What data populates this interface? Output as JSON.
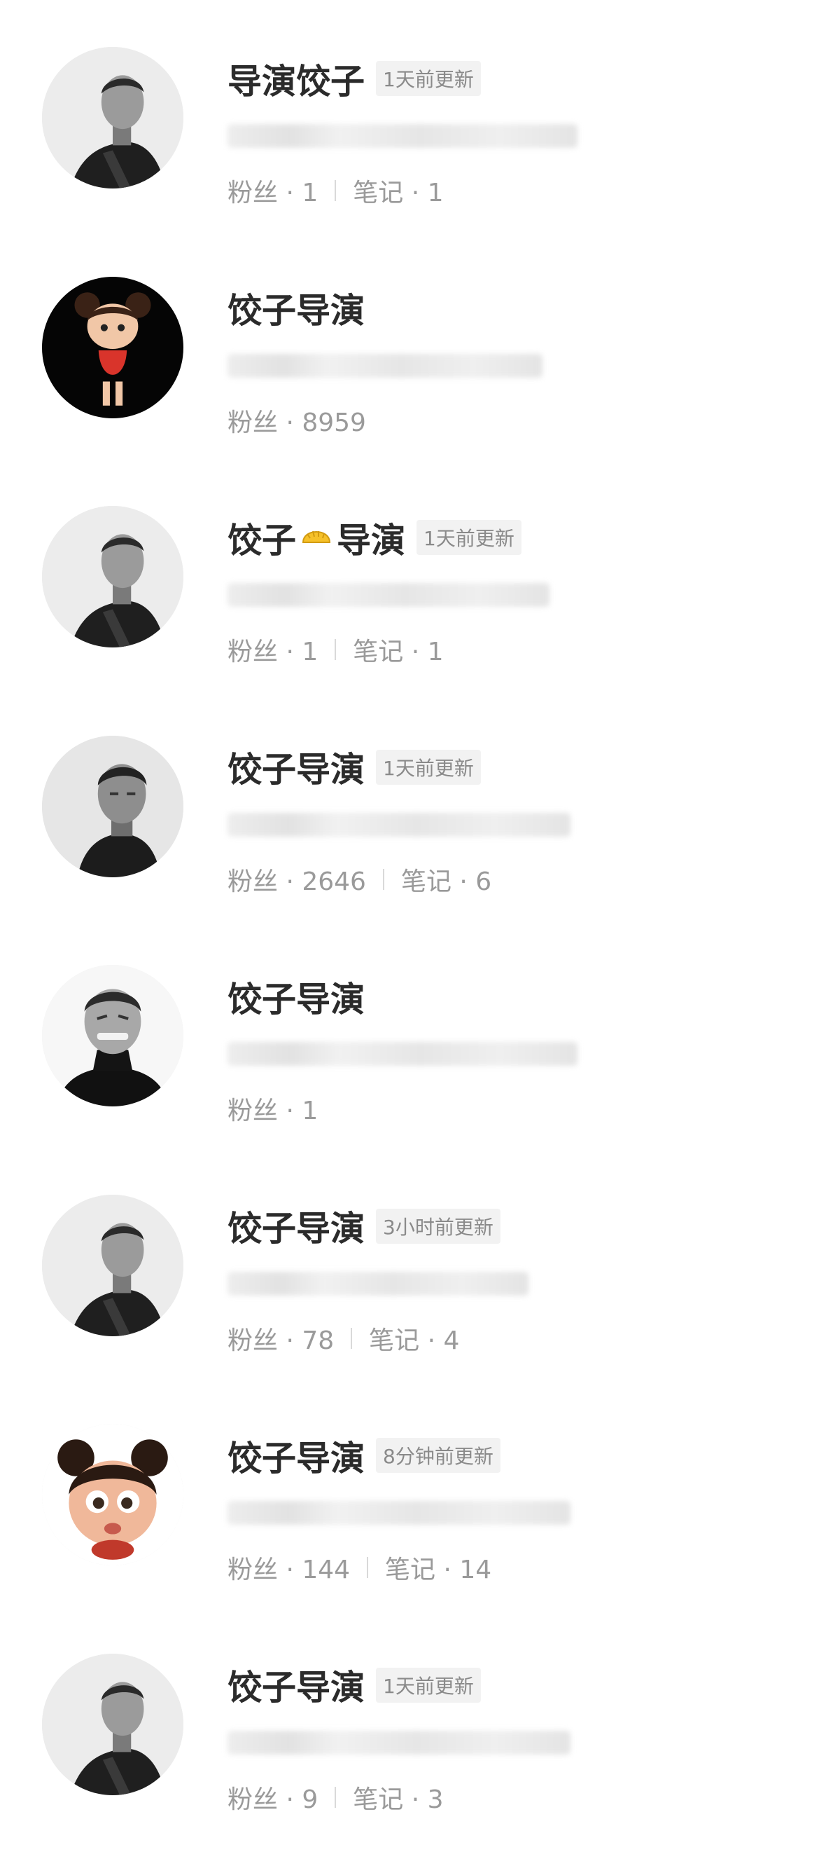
{
  "results": [
    {
      "name": "导演饺子",
      "badge": "1天前更新",
      "fans": "粉丝 · 1",
      "notes": "笔记 · 1",
      "avatar": "man-black-coat-avatar",
      "desc_width": 500
    },
    {
      "name": "饺子导演",
      "badge": "",
      "fans": "粉丝 · 8959",
      "notes": "",
      "avatar": "nezha-girl-avatar",
      "desc_width": 450
    },
    {
      "name_left": "饺子",
      "name_right": "导演",
      "emoji": "dumpling-emoji",
      "badge": "1天前更新",
      "fans": "粉丝 · 1",
      "notes": "笔记 · 1",
      "avatar": "man-black-coat-avatar",
      "desc_width": 460
    },
    {
      "name": "饺子导演",
      "badge": "1天前更新",
      "fans": "粉丝 · 2646",
      "notes": "笔记 · 6",
      "avatar": "man-portrait-avatar",
      "desc_width": 490
    },
    {
      "name": "饺子导演",
      "badge": "",
      "fans": "粉丝 · 1",
      "notes": "",
      "avatar": "man-grinning-avatar",
      "desc_width": 500
    },
    {
      "name": "饺子导演",
      "badge": "3小时前更新",
      "fans": "粉丝 · 78",
      "notes": "笔记 · 4",
      "avatar": "man-black-coat-avatar",
      "desc_width": 430
    },
    {
      "name": "饺子导演",
      "badge": "8分钟前更新",
      "fans": "粉丝 · 144",
      "notes": "笔记 · 14",
      "avatar": "nezha-face-avatar",
      "desc_width": 490
    },
    {
      "name": "饺子导演",
      "badge": "1天前更新",
      "fans": "粉丝 · 9",
      "notes": "笔记 · 3",
      "avatar": "man-black-coat-avatar",
      "desc_width": 490
    }
  ]
}
